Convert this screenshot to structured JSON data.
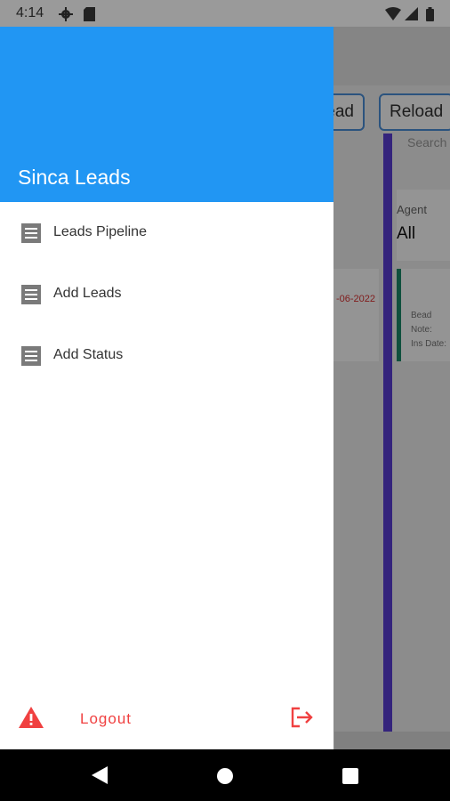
{
  "status_bar": {
    "time": "4:14",
    "icons": [
      "settings-icon",
      "sim-card-icon",
      "wifi-icon",
      "signal-icon",
      "battery-icon"
    ]
  },
  "background_app": {
    "button_partial": "ead",
    "reload_button": "Reload",
    "search_placeholder": "Search",
    "agent_label": "Agent",
    "agent_value": "All",
    "card_date": "-06-2022",
    "card_lines": [
      "Bead",
      "Note:",
      "Ins Date:"
    ]
  },
  "drawer": {
    "app_title": "Sinca Leads",
    "header_color": "#2196F3",
    "menu_items": [
      {
        "label": "Leads Pipeline",
        "icon": "list-icon"
      },
      {
        "label": "Add Leads",
        "icon": "list-icon"
      },
      {
        "label": "Add Status",
        "icon": "list-icon"
      }
    ],
    "logout_label": "Logout",
    "logout_color": "#F04040"
  },
  "nav_bar": {
    "icons": [
      "back-icon",
      "home-icon",
      "recents-icon"
    ]
  }
}
